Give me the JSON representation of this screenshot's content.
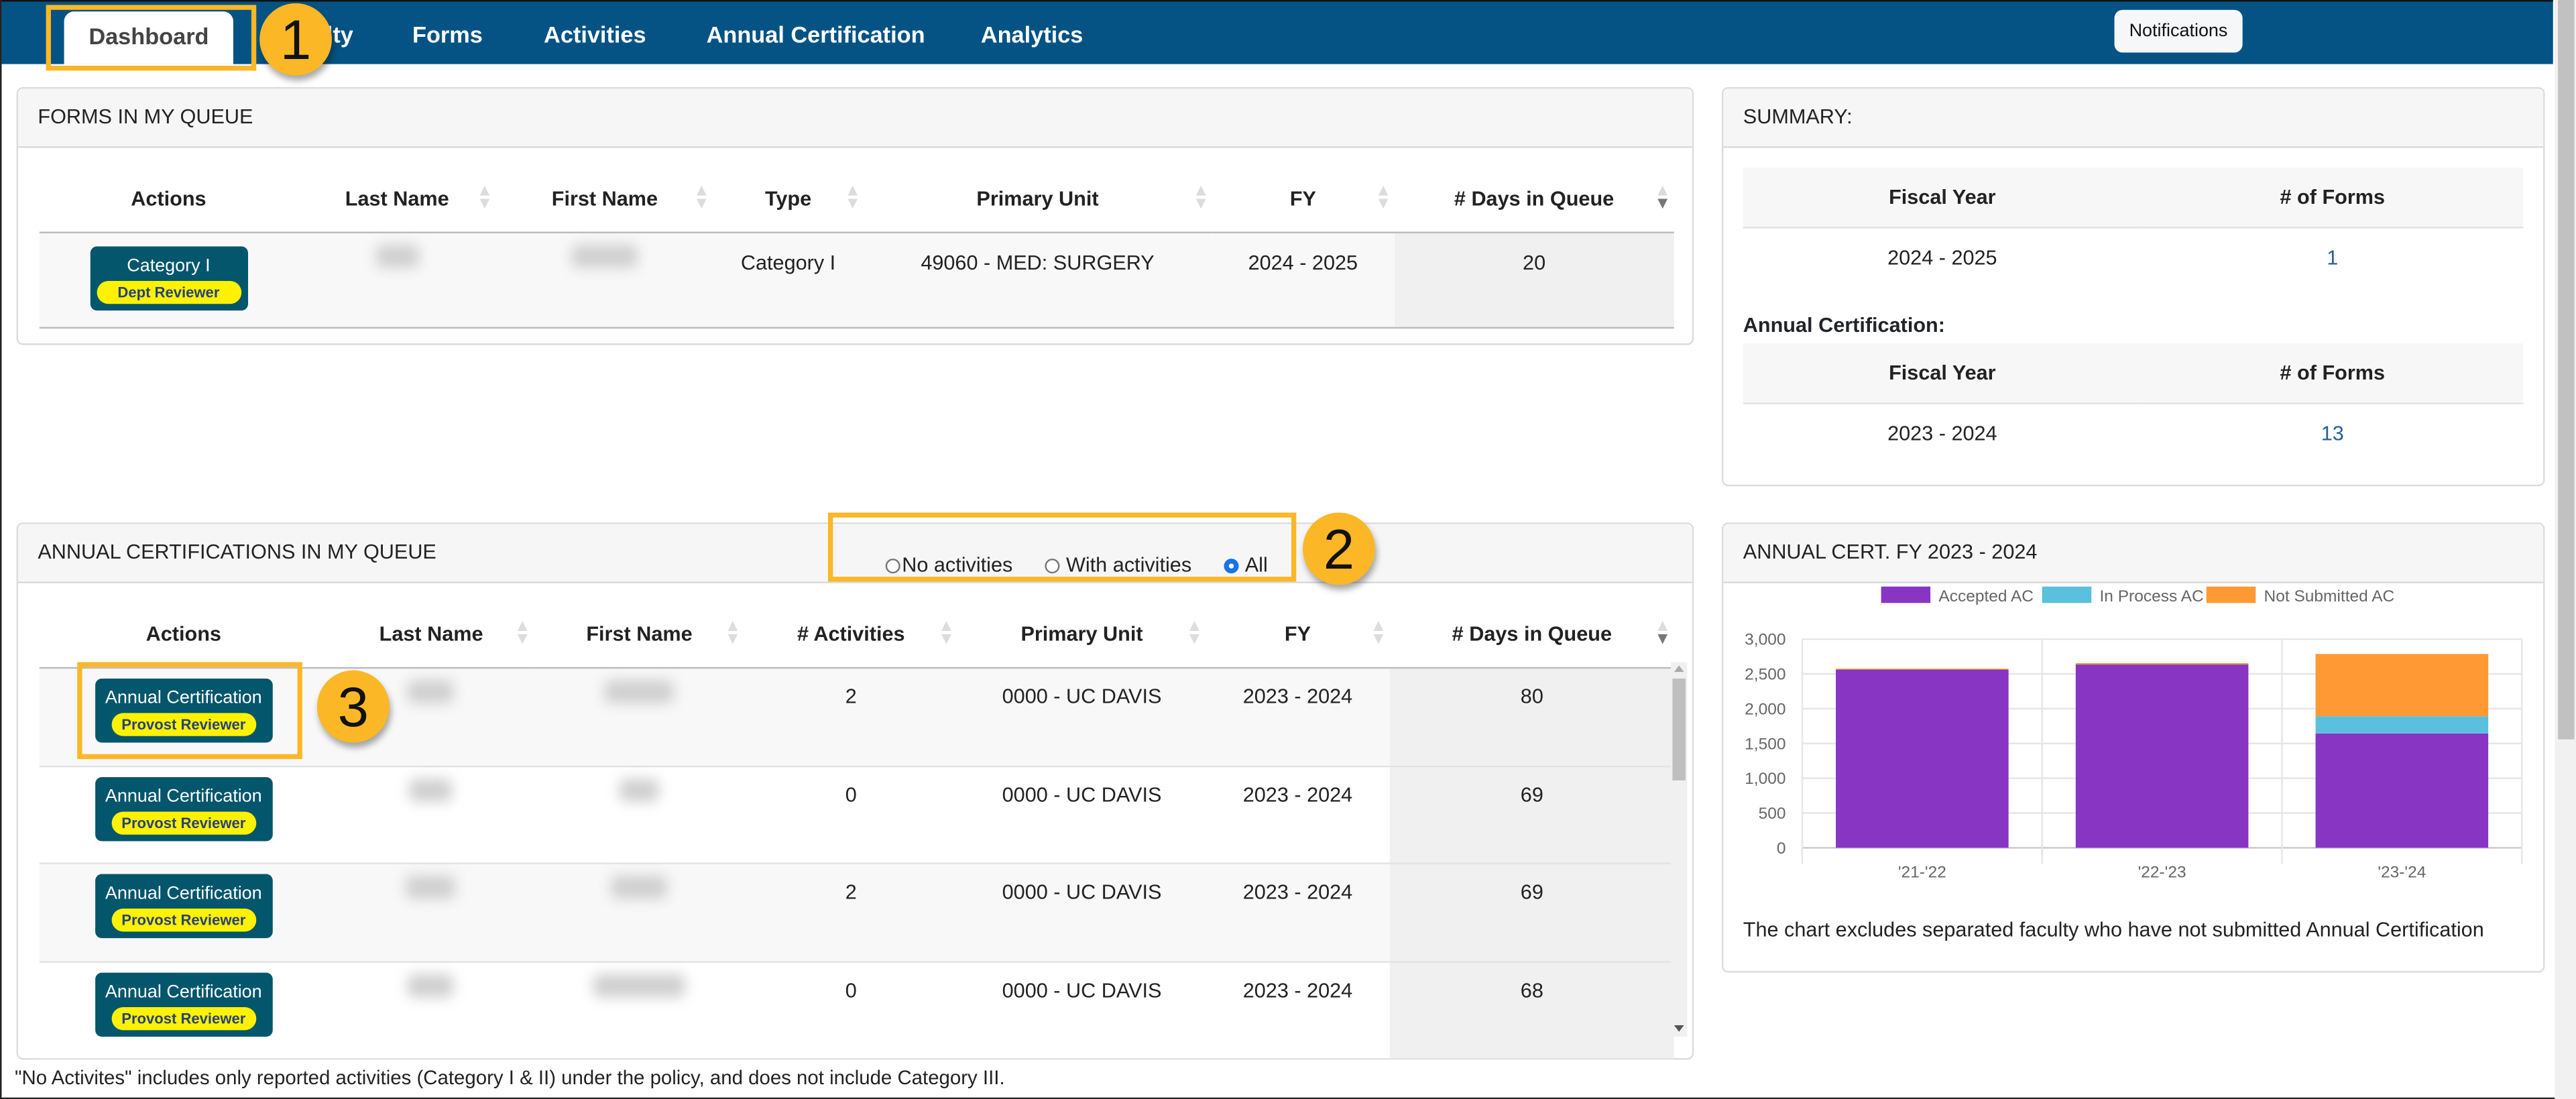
{
  "nav": {
    "tabs": [
      {
        "label": "Dashboard",
        "active": true
      },
      {
        "label": "Faculty"
      },
      {
        "label": "Forms"
      },
      {
        "label": "Activities"
      },
      {
        "label": "Annual Certification"
      },
      {
        "label": "Analytics"
      }
    ],
    "notifications_label": "Notifications"
  },
  "markers": [
    "1",
    "2",
    "3"
  ],
  "forms_queue": {
    "title": "FORMS IN MY QUEUE",
    "columns": [
      "Actions",
      "Last Name",
      "First Name",
      "Type",
      "Primary Unit",
      "FY",
      "# Days in Queue"
    ],
    "rows": [
      {
        "action": "Category I",
        "role": "Dept Reviewer",
        "type": "Category I",
        "primary_unit": "49060 - MED: SURGERY",
        "fy": "2024 - 2025",
        "days": "20"
      }
    ]
  },
  "summary": {
    "title": "SUMMARY:",
    "forms_table": {
      "columns": [
        "Fiscal Year",
        "# of Forms"
      ],
      "rows": [
        {
          "fy": "2024 - 2025",
          "count": "1"
        }
      ]
    },
    "ac_label": "Annual Certification:",
    "ac_table": {
      "columns": [
        "Fiscal Year",
        "# of Forms"
      ],
      "rows": [
        {
          "fy": "2023 - 2024",
          "count": "13"
        }
      ]
    }
  },
  "ac_queue": {
    "title": "ANNUAL CERTIFICATIONS IN MY QUEUE",
    "filter": {
      "options": [
        "No activities",
        "With activities",
        "All"
      ],
      "selected": "All"
    },
    "columns": [
      "Actions",
      "Last Name",
      "First Name",
      "# Activities",
      "Primary Unit",
      "FY",
      "# Days in Queue"
    ],
    "rows": [
      {
        "action": "Annual Certification",
        "role": "Provost Reviewer",
        "activities": "2",
        "primary_unit": "0000 - UC DAVIS",
        "fy": "2023 - 2024",
        "days": "80"
      },
      {
        "action": "Annual Certification",
        "role": "Provost Reviewer",
        "activities": "0",
        "primary_unit": "0000 - UC DAVIS",
        "fy": "2023 - 2024",
        "days": "69"
      },
      {
        "action": "Annual Certification",
        "role": "Provost Reviewer",
        "activities": "2",
        "primary_unit": "0000 - UC DAVIS",
        "fy": "2023 - 2024",
        "days": "69"
      },
      {
        "action": "Annual Certification",
        "role": "Provost Reviewer",
        "activities": "0",
        "primary_unit": "0000 - UC DAVIS",
        "fy": "2023 - 2024",
        "days": "68"
      }
    ]
  },
  "chart_card": {
    "title": "ANNUAL CERT. FY 2023 - 2024",
    "note": "The chart excludes separated faculty who have not submitted Annual Certification"
  },
  "chart_data": {
    "type": "bar",
    "stacked": true,
    "title": "ANNUAL CERT. FY 2023 - 2024",
    "categories": [
      "'21-'22",
      "'22-'23",
      "'23-'24"
    ],
    "series": [
      {
        "name": "Accepted AC",
        "color": "#8835c4",
        "values": [
          2565,
          2635,
          1643
        ]
      },
      {
        "name": "In Process AC",
        "color": "#5bc0de",
        "values": [
          0,
          0,
          248
        ]
      },
      {
        "name": "Not Submitted AC",
        "color": "#ff9933",
        "values": [
          10,
          20,
          895
        ]
      }
    ],
    "yticks": [
      0,
      500,
      1000,
      1500,
      2000,
      2500,
      3000
    ],
    "ylim": [
      0,
      3000
    ],
    "xlabel": "",
    "ylabel": "",
    "grid": true,
    "legend": "top"
  },
  "footnote": "\"No Activites\" includes only reported activities (Category I & II) under the policy, and does not include Category III.",
  "colors": {
    "navbar": "#045384",
    "action_button": "#04566c",
    "role_badge": "#fff200",
    "highlight": "#fbb726"
  }
}
